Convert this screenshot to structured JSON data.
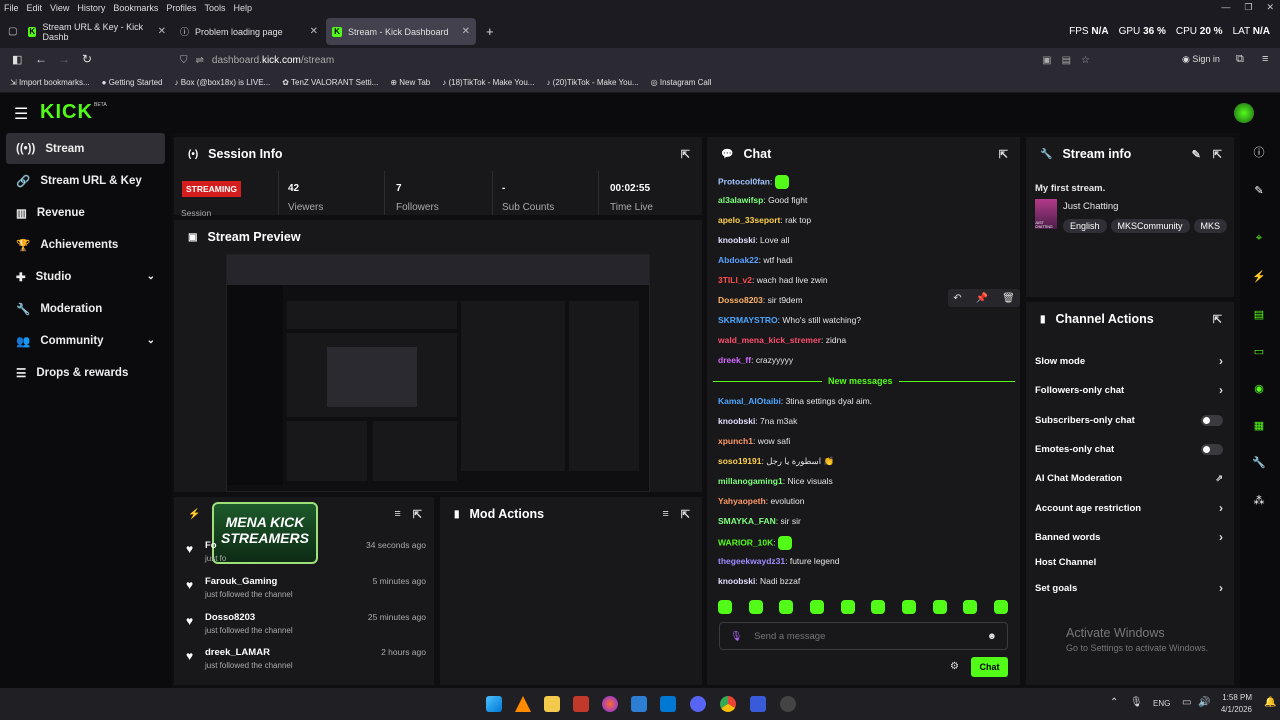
{
  "browser": {
    "menu": [
      "File",
      "Edit",
      "View",
      "History",
      "Bookmarks",
      "Profiles",
      "Tools",
      "Help"
    ],
    "perf": {
      "fps_label": "FPS",
      "fps": "N/A",
      "gpu_label": "GPU",
      "gpu": "36 %",
      "cpu_label": "CPU",
      "cpu": "20 %",
      "lat_label": "LAT",
      "lat": "N/A"
    },
    "tabs": [
      {
        "title": "Stream URL & Key - Kick Dashb"
      },
      {
        "title": "Problem loading page"
      },
      {
        "title": "Stream - Kick Dashboard"
      }
    ],
    "url_prefix": "dashboard.",
    "url_domain": "kick.com",
    "url_path": "/stream",
    "sign_in": "Sign in",
    "bookmarks": [
      "Import bookmarks...",
      "Getting Started",
      "Box (@box18x) is LIVE...",
      "TenZ VALORANT Setti...",
      "New Tab",
      "(18)TikTok - Make You...",
      "(20)TikTok - Make You...",
      "Instagram Call"
    ]
  },
  "kick": {
    "logo": "KICK",
    "beta": "BETA",
    "sidebar": [
      {
        "label": "Stream",
        "icon": "signal-icon"
      },
      {
        "label": "Stream URL & Key",
        "icon": "link-icon"
      },
      {
        "label": "Revenue",
        "icon": "chart-icon"
      },
      {
        "label": "Achievements",
        "icon": "trophy-icon"
      },
      {
        "label": "Studio",
        "icon": "joystick-icon"
      },
      {
        "label": "Moderation",
        "icon": "wrench-icon"
      },
      {
        "label": "Community",
        "icon": "people-icon"
      },
      {
        "label": "Drops & rewards",
        "icon": "list-icon"
      }
    ],
    "session": {
      "title": "Session Info",
      "status": "STREAMING",
      "session_label": "Session",
      "viewers": "42",
      "viewers_label": "Viewers",
      "followers": "7",
      "followers_label": "Followers",
      "subs": "-",
      "subs_label": "Sub Counts",
      "time": "00:02:55",
      "time_label": "Time Live"
    },
    "preview_title": "Stream Preview",
    "activity": {
      "badge_line1": "MENA KICK",
      "badge_line2": "STREAMERS",
      "items": [
        {
          "name": "Fo",
          "sub": "just fo",
          "time": "34 seconds ago"
        },
        {
          "name": "Farouk_Gaming",
          "sub": "just followed the channel",
          "time": "5 minutes ago"
        },
        {
          "name": "Dosso8203",
          "sub": "just followed the channel",
          "time": "25 minutes ago"
        },
        {
          "name": "dreek_LAMAR",
          "sub": "just followed the channel",
          "time": "2 hours ago"
        }
      ]
    },
    "mod_actions_title": "Mod Actions",
    "chat": {
      "title": "Chat",
      "lines": [
        {
          "user": "Protocol0fan",
          "msg": "",
          "color": "#a3c6ff",
          "emote": true
        },
        {
          "user": "al3alawifsp",
          "msg": "Good fight",
          "color": "#7dff7d"
        },
        {
          "user": "apelo_33seport",
          "msg": "rak top",
          "color": "#ffd24d"
        },
        {
          "user": "knoobski",
          "msg": "Love all",
          "color": "#e0e0ff"
        },
        {
          "user": "Abdoak22",
          "msg": "wtf hadi",
          "color": "#5aa2ff"
        },
        {
          "user": "3TILI_v2",
          "msg": "wach had live zwin",
          "color": "#ff4d4d"
        },
        {
          "user": "Dosso8203",
          "msg": "sir t9dem",
          "color": "#ffb366"
        },
        {
          "user": "SKRMAYSTRO",
          "msg": "Who's still watching?",
          "color": "#4da6ff"
        },
        {
          "user": "wald_mena_kick_stremer",
          "msg": "zidna",
          "color": "#ff4d6d"
        },
        {
          "user": "dreek_ff",
          "msg": "crazyyyyy",
          "color": "#d26bff"
        }
      ],
      "new_messages": "New messages",
      "new_lines": [
        {
          "user": "Kamal_AlOtaibi",
          "msg": "3tina settings dyal aim.",
          "color": "#4da6ff"
        },
        {
          "user": "knoobski",
          "msg": "7na m3ak",
          "color": "#e0e0ff"
        },
        {
          "user": "xpunch1",
          "msg": "wow safi",
          "color": "#ff9966"
        },
        {
          "user": "soso19191",
          "msg": "اسطورة يا رجل 👏",
          "color": "#ffd24d"
        },
        {
          "user": "millanogaming1",
          "msg": "Nice visuals",
          "color": "#7dff7d"
        },
        {
          "user": "Yahyaopeth",
          "msg": "evolution",
          "color": "#ff9966"
        },
        {
          "user": "SMAYKA_FAN",
          "msg": "sir sir",
          "color": "#7dff7d"
        },
        {
          "user": "WARIOR_10K",
          "msg": "",
          "color": "#53fc18",
          "emote": true
        },
        {
          "user": "thegeekwaydz31",
          "msg": "future legend",
          "color": "#9f8cff"
        },
        {
          "user": "knoobski",
          "msg": "Nadi bzzaf",
          "color": "#e0e0ff"
        }
      ],
      "placeholder": "Send a message",
      "send": "Chat"
    },
    "stream_info": {
      "title": "Stream info",
      "stream_title": "My first stream.",
      "category": "Just Chatting",
      "category_thumb": "JUST CHATTING",
      "tags": [
        "English",
        "MKSCommunity",
        "MKS"
      ]
    },
    "channel_actions": {
      "title": "Channel Actions",
      "items": [
        {
          "label": "Slow mode",
          "kind": "chevron"
        },
        {
          "label": "Followers-only chat",
          "kind": "chevron"
        },
        {
          "label": "Subscribers-only chat",
          "kind": "toggle"
        },
        {
          "label": "Emotes-only chat",
          "kind": "toggle"
        },
        {
          "label": "AI Chat Moderation",
          "kind": "external"
        },
        {
          "label": "Account age restriction",
          "kind": "chevron"
        },
        {
          "label": "Banned words",
          "kind": "chevron"
        },
        {
          "label": "Host Channel",
          "kind": "none"
        },
        {
          "label": "Set goals",
          "kind": "chevron"
        }
      ]
    },
    "watermark": {
      "line1": "Activate Windows",
      "line2": "Go to Settings to activate Windows."
    }
  },
  "taskbar": {
    "lang": "ENG",
    "time": "1:58 PM",
    "date": "4/1/2026"
  }
}
